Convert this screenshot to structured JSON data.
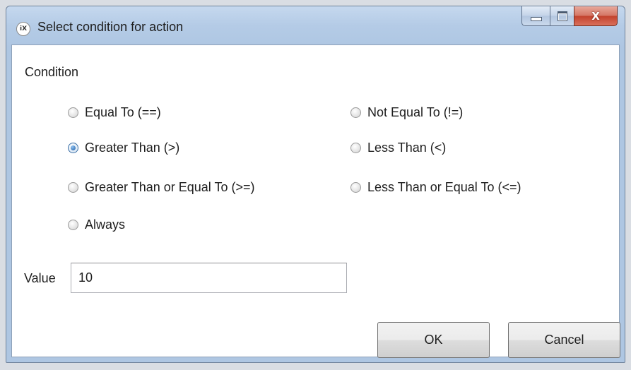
{
  "window": {
    "title": "Select condition for action",
    "icon_text": "iX",
    "close_glyph": "X"
  },
  "condition": {
    "label": "Condition",
    "selected": "gt",
    "options": [
      {
        "id": "eq",
        "label": "Equal To (==)"
      },
      {
        "id": "ne",
        "label": "Not Equal To (!=)"
      },
      {
        "id": "gt",
        "label": "Greater Than (>)"
      },
      {
        "id": "lt",
        "label": "Less Than (<)"
      },
      {
        "id": "ge",
        "label": "Greater Than or Equal To (>=)"
      },
      {
        "id": "le",
        "label": "Less Than or Equal To (<=)"
      },
      {
        "id": "always",
        "label": "Always"
      }
    ]
  },
  "value": {
    "label": "Value",
    "current": "10"
  },
  "buttons": {
    "ok_label": "OK",
    "cancel_label": "Cancel"
  }
}
